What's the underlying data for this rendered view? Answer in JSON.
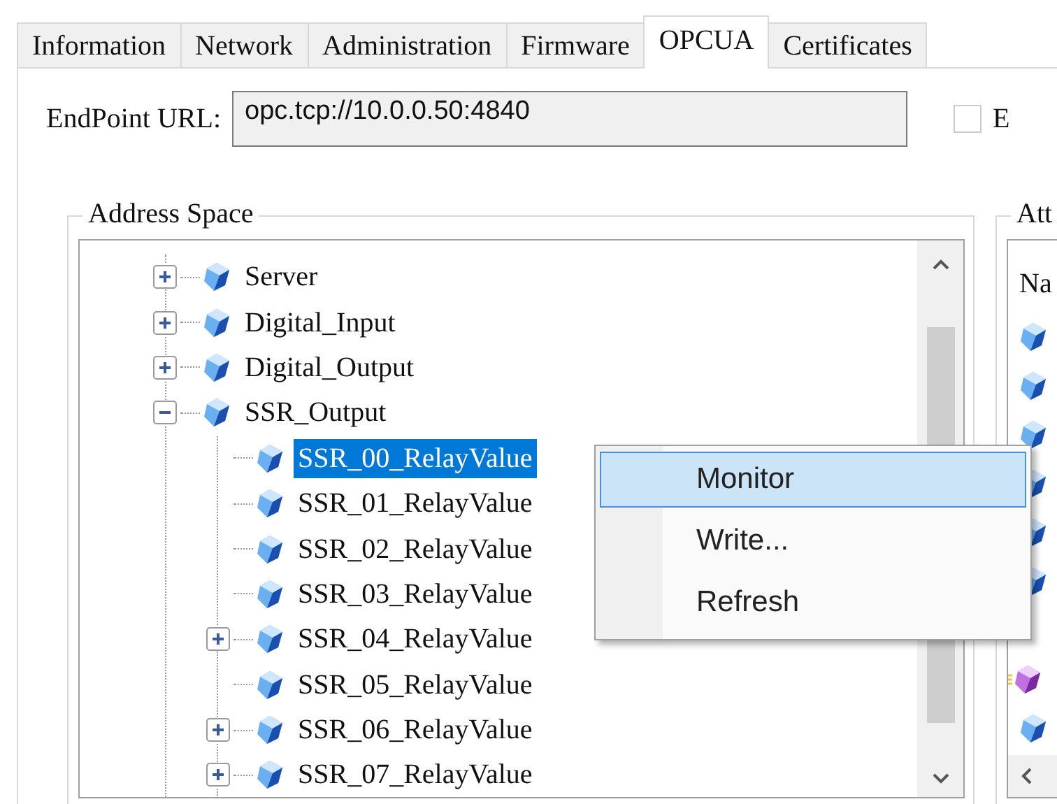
{
  "tabs": [
    {
      "label": "Information",
      "selected": false
    },
    {
      "label": "Network",
      "selected": false
    },
    {
      "label": "Administration",
      "selected": false
    },
    {
      "label": "Firmware",
      "selected": false
    },
    {
      "label": "OPCUA",
      "selected": true
    },
    {
      "label": "Certificates",
      "selected": false
    }
  ],
  "endpoint": {
    "label": "EndPoint URL:",
    "value": "opc.tcp://10.0.0.50:4840"
  },
  "option_checkbox": {
    "label": "E",
    "checked": false
  },
  "address_space": {
    "title": "Address Space",
    "tree": [
      {
        "label": "Server",
        "expanded": false,
        "selected": false
      },
      {
        "label": "Digital_Input",
        "expanded": false,
        "selected": false
      },
      {
        "label": "Digital_Output",
        "expanded": false,
        "selected": false
      },
      {
        "label": "SSR_Output",
        "expanded": true,
        "selected": false,
        "children": [
          {
            "label": "SSR_00_RelayValue",
            "selected": true
          },
          {
            "label": "SSR_01_RelayValue",
            "selected": false
          },
          {
            "label": "SSR_02_RelayValue",
            "selected": false
          },
          {
            "label": "SSR_03_RelayValue",
            "selected": false
          },
          {
            "label": "SSR_04_RelayValue",
            "expanded": false,
            "selected": false
          },
          {
            "label": "SSR_05_RelayValue",
            "selected": false
          },
          {
            "label": "SSR_06_RelayValue",
            "expanded": false,
            "selected": false
          },
          {
            "label": "SSR_07_RelayValue",
            "expanded": false,
            "selected": false
          }
        ]
      }
    ]
  },
  "attributes": {
    "title": "Att",
    "header": "Na",
    "rows": [
      {
        "kind": "variable"
      },
      {
        "kind": "variable"
      },
      {
        "kind": "variable"
      },
      {
        "kind": "variable"
      },
      {
        "kind": "variable"
      },
      {
        "kind": "variable"
      },
      {
        "kind": "method"
      },
      {
        "kind": "variable"
      }
    ]
  },
  "context_menu": [
    {
      "label": "Monitor",
      "selected": true
    },
    {
      "label": "Write...",
      "selected": false
    },
    {
      "label": "Refresh",
      "selected": false
    }
  ]
}
